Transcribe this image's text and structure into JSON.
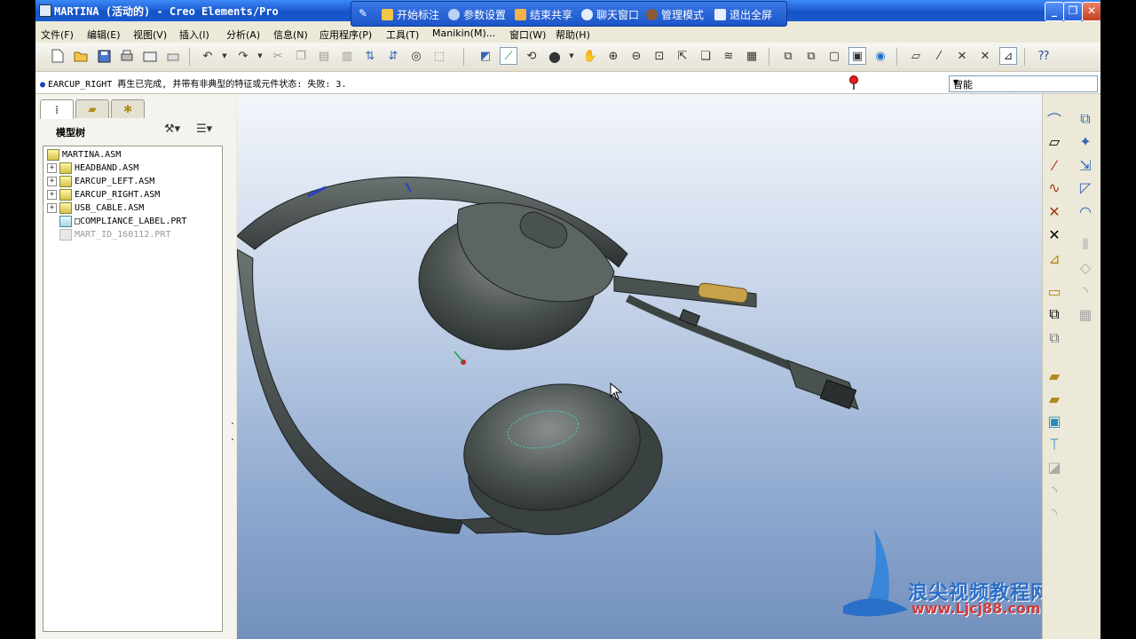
{
  "window": {
    "title": "MARTINA (活动的) - Creo Elements/Pro",
    "minimize": "_",
    "restore": "❐",
    "close": "✕"
  },
  "sharebar": {
    "items": [
      {
        "label": "开始标注"
      },
      {
        "label": "参数设置"
      },
      {
        "label": "结束共享"
      },
      {
        "label": "聊天窗口"
      },
      {
        "label": "管理模式"
      },
      {
        "label": "退出全屏"
      }
    ]
  },
  "menubar": {
    "items": [
      "文件(F)",
      "编辑(E)",
      "视图(V)",
      "插入(I)",
      "分析(A)",
      "信息(N)",
      "应用程序(P)",
      "工具(T)",
      "Manikin(M)...",
      "窗口(W)",
      "帮助(H)"
    ]
  },
  "message": {
    "bullet": "●",
    "text": "EARCUP_RIGHT 再生已完成, 并带有非典型的特征或元件状态: 失败: 3."
  },
  "filter": {
    "value": "智能"
  },
  "model_tree": {
    "title": "模型树",
    "items": [
      {
        "label": "MARTINA.ASM"
      },
      {
        "label": "HEADBAND.ASM"
      },
      {
        "label": "EARCUP_LEFT.ASM"
      },
      {
        "label": "EARCUP_RIGHT.ASM"
      },
      {
        "label": "USB_CABLE.ASM"
      },
      {
        "label": "□COMPLIANCE_LABEL.PRT"
      },
      {
        "label": "MART_ID_160112.PRT"
      }
    ]
  },
  "watermark": {
    "name": "浪尖视频教程网",
    "url": "www.Ljcj88.com"
  },
  "colors": {
    "titlebar": "#1e5fd6",
    "background_top": "#f3f6fb",
    "background_bottom": "#7390bd",
    "model": "#3d4548"
  }
}
